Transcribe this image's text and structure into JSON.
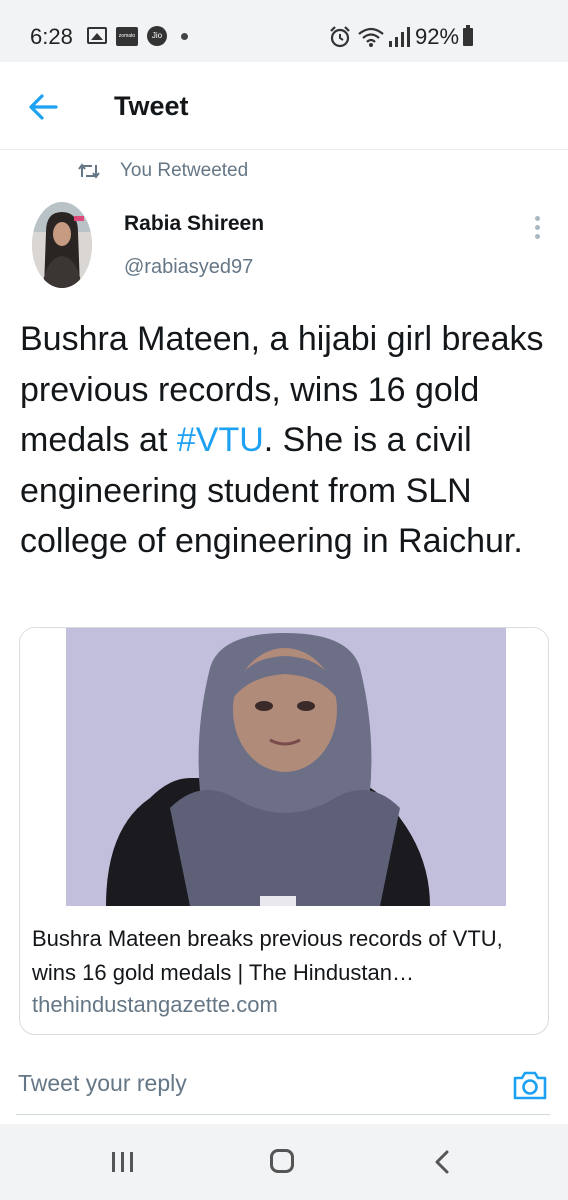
{
  "status_bar": {
    "time": "6:28",
    "icons": [
      "gallery-icon",
      "zomato-icon",
      "jio-icon",
      "dot-icon",
      "alarm-icon",
      "wifi-icon",
      "signal-icon",
      "battery-icon"
    ],
    "zomato_label": "zomato",
    "jio_label": "Jio",
    "battery_percent": "92%"
  },
  "header": {
    "title": "Tweet",
    "back_icon": "arrow-left-icon"
  },
  "retweet": {
    "icon": "retweet-icon",
    "label": "You Retweeted"
  },
  "author": {
    "name": "Rabia Shireen",
    "handle": "@rabiasyed97"
  },
  "tweet": {
    "text_before": "Bushra Mateen, a hijabi girl breaks previous records, wins 16 gold medals at ",
    "hashtag": "#VTU",
    "text_after": ". She is a civil engineering student from SLN college of engineering in Raichur."
  },
  "card": {
    "title": "Bushra Mateen breaks previous records of VTU, wins 16 gold medals | The Hindustan…",
    "domain": "thehindustangazette.com"
  },
  "reply": {
    "placeholder": "Tweet your reply",
    "camera_icon": "camera-icon"
  },
  "nav": {
    "icons": [
      "recents-icon",
      "home-icon",
      "back-icon"
    ]
  },
  "colors": {
    "accent": "#1da1f2",
    "secondary_text": "#657786",
    "primary_text": "#14171a"
  }
}
